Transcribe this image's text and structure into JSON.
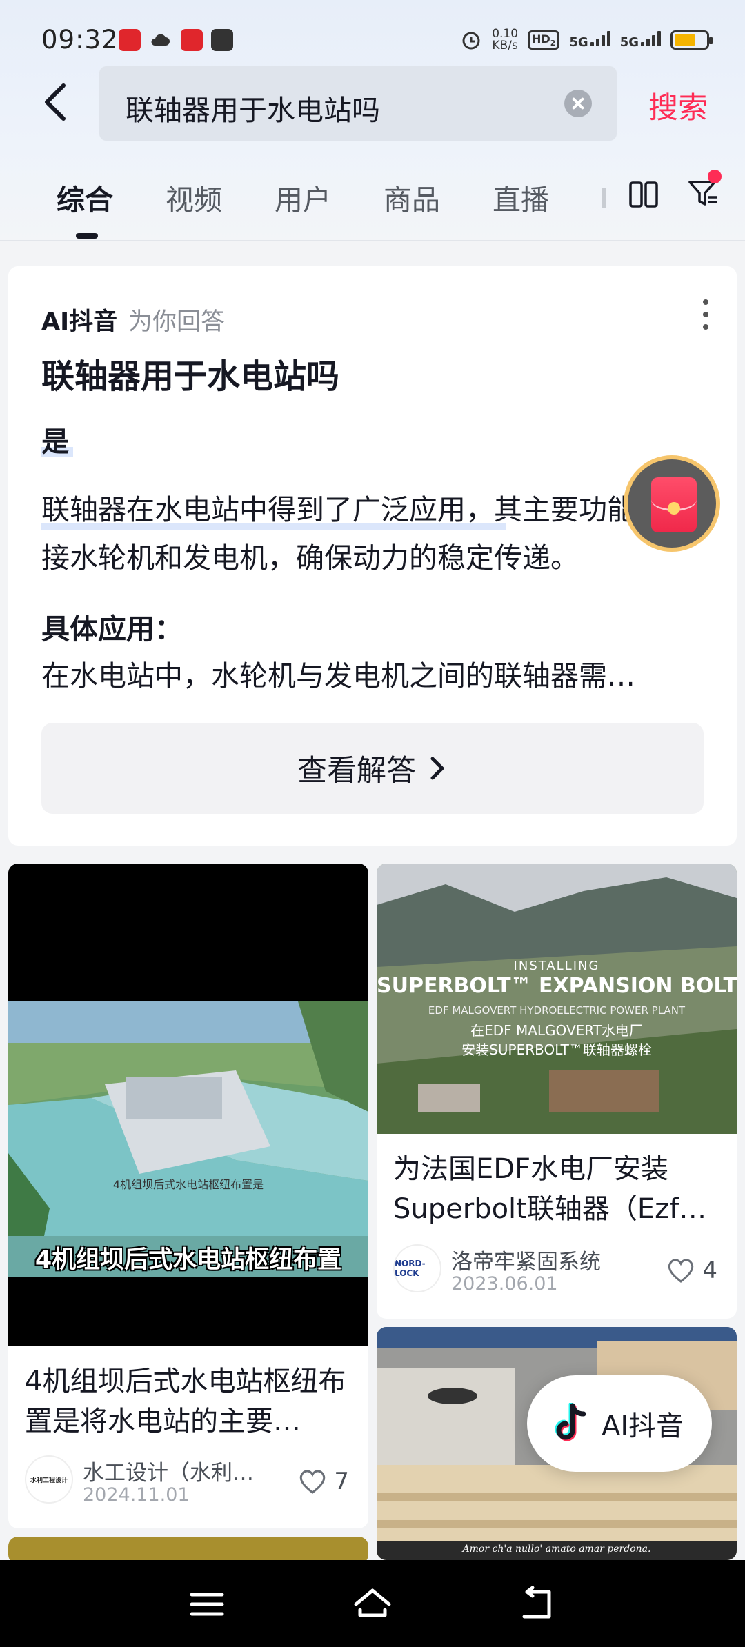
{
  "status_bar": {
    "time": "09:32",
    "net_speed_value": "0.10",
    "net_speed_unit": "KB/s",
    "hd_label": "HD",
    "hd_sub": "2",
    "signal_1": "5G",
    "signal_2": "5G"
  },
  "search": {
    "query": "联轴器用于水电站吗",
    "submit_label": "搜索"
  },
  "tabs": [
    {
      "label": "综合",
      "active": true
    },
    {
      "label": "视频",
      "active": false
    },
    {
      "label": "用户",
      "active": false
    },
    {
      "label": "商品",
      "active": false
    },
    {
      "label": "直播",
      "active": false
    }
  ],
  "ai_answer": {
    "brand": "AI抖音",
    "subtitle": "为你回答",
    "question": "联轴器用于水电站吗",
    "verdict": "是",
    "paragraph": "联轴器在水电站中得到了广泛应用，其主要功能是连接水轮机和发电机，确保动力的稳定传递。",
    "subheading": "具体应用：",
    "snippet": "在水电站中，水轮机与发电机之间的联轴器需…",
    "button_label": "查看解答"
  },
  "feed": [
    {
      "thumb_caption": "4机组坝后式水电站枢纽布置",
      "thumb_small": "4机组坝后式水电站枢纽布置是",
      "title": "4机组坝后式水电站枢纽布置是将水电站的主要…",
      "author": "水工设计（水利…",
      "avatar_text": "水利工程设计",
      "date": "2024.11.01",
      "likes": "7"
    },
    {
      "thumb_lines": [
        "INSTALLING",
        "SUPERBOLT™ EXPANSION BOLTS",
        "EDF MALGOVERT HYDROELECTRIC POWER PLANT",
        "在EDF MALGOVERT水电厂",
        "安装SUPERBOLT™联轴器螺栓"
      ],
      "title": "为法国EDF水电厂安装Superbolt联轴器（Ezf…",
      "author": "洛帝牢紧固系统",
      "avatar_text": "NORD-LOCK",
      "date": "2023.06.01",
      "likes": "4"
    },
    {
      "thumb_caption": "Amor ch'a nullo' amato amar perdona."
    }
  ],
  "ai_pill": {
    "label": "AI抖音"
  },
  "colors": {
    "accent": "#fe2c55",
    "text": "#161823"
  }
}
